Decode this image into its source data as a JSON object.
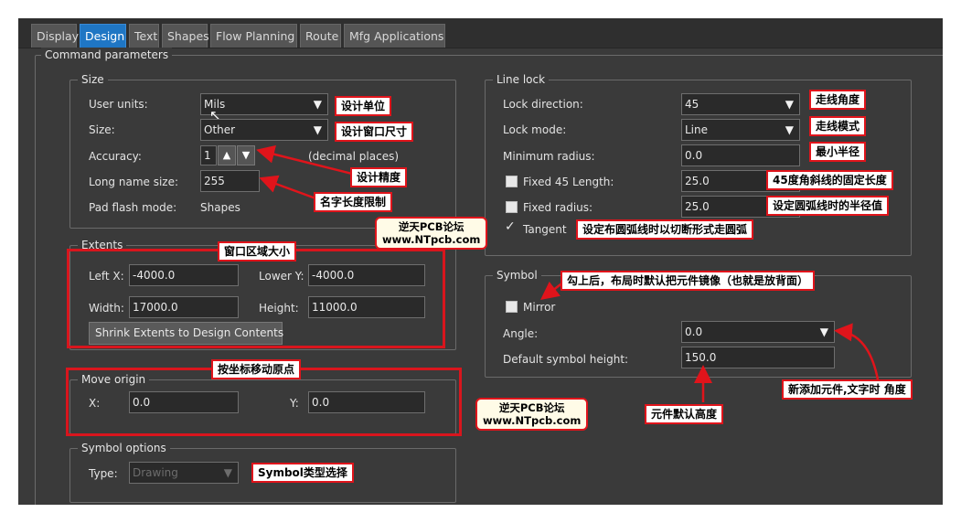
{
  "tabs": [
    "Display",
    "Design",
    "Text",
    "Shapes",
    "Flow Planning",
    "Route",
    "Mfg Applications"
  ],
  "active_tab": "Design",
  "command_parameters": {
    "title": "Command parameters"
  },
  "size": {
    "title": "Size",
    "user_units_label": "User units:",
    "user_units_value": "Mils",
    "size_label": "Size:",
    "size_value": "Other",
    "accuracy_label": "Accuracy:",
    "accuracy_value": "1",
    "accuracy_suffix": "(decimal places)",
    "long_name_label": "Long name size:",
    "long_name_value": "255",
    "pad_flash_label": "Pad flash mode:",
    "pad_flash_value": "Shapes"
  },
  "extents": {
    "title": "Extents",
    "left_x_label": "Left X:",
    "left_x_value": "-4000.0",
    "lower_y_label": "Lower Y:",
    "lower_y_value": "-4000.0",
    "width_label": "Width:",
    "width_value": "17000.0",
    "height_label": "Height:",
    "height_value": "11000.0",
    "shrink_button": "Shrink Extents to Design Contents"
  },
  "move_origin": {
    "title": "Move origin",
    "x_label": "X:",
    "x_value": "0.0",
    "y_label": "Y:",
    "y_value": "0.0"
  },
  "symbol_options": {
    "title": "Symbol options",
    "type_label": "Type:",
    "type_value": "Drawing"
  },
  "line_lock": {
    "title": "Line lock",
    "lock_direction_label": "Lock direction:",
    "lock_direction_value": "45",
    "lock_mode_label": "Lock mode:",
    "lock_mode_value": "Line",
    "min_radius_label": "Minimum radius:",
    "min_radius_value": "0.0",
    "fixed45_label": "Fixed 45 Length:",
    "fixed45_value": "25.0",
    "fixed_radius_label": "Fixed radius:",
    "fixed_radius_value": "25.0",
    "tangent_label": "Tangent"
  },
  "symbol": {
    "title": "Symbol",
    "mirror_label": "Mirror",
    "angle_label": "Angle:",
    "angle_value": "0.0",
    "default_height_label": "Default symbol height:",
    "default_height_value": "150.0"
  },
  "annotations": {
    "user_units": "设计单位",
    "size": "设计窗口尺寸",
    "accuracy": "设计精度",
    "long_name": "名字长度限制",
    "extents": "窗口区域大小",
    "move_origin": "按坐标移动原点",
    "symbol_type": "Symbol类型选择",
    "lock_direction": "走线角度",
    "lock_mode": "走线模式",
    "min_radius": "最小半径",
    "fixed45": "45度角斜线的固定长度",
    "fixed_radius": "设定圆弧线时的半径值",
    "tangent": "设定布圆弧线时以切断形式走圆弧",
    "mirror": "勾上后，布局时默认把元件镜像（也就是放背面）",
    "angle": "新添加元件,文字时 角度",
    "default_height": "元件默认高度"
  },
  "watermark": {
    "line1": "逆天PCB论坛",
    "line2": "www.NTpcb.com"
  },
  "colors": {
    "active_tab": "#1f76c4",
    "annotation_border": "#e0141b",
    "panel_bg": "#3a3a3a"
  }
}
